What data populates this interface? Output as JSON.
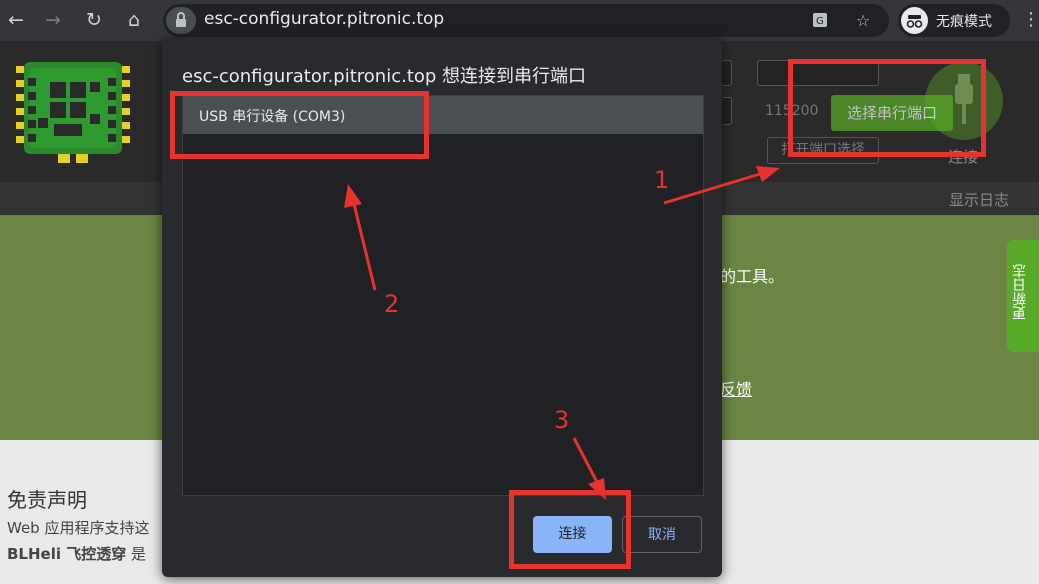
{
  "browser": {
    "url": "esc-configurator.pitronic.top",
    "incognito_label": "无痕模式"
  },
  "page": {
    "baud_value": "115200",
    "choose_port_button": "选择串行端口",
    "open_port_button": "打开端口选择",
    "connect_label": "连接",
    "show_log": "显示日志",
    "green_text_1": "的工具。",
    "green_text_2": "反馈",
    "update_log_tab": "更新日志",
    "disclaimer_title": "免责声明",
    "disclaimer_line_1": "Web 应用程序支持这",
    "disclaimer_line_2_bold": "BLHeli 飞控透穿",
    "disclaimer_line_2_rest": " 是"
  },
  "dialog": {
    "title": "esc-configurator.pitronic.top 想连接到串行端口",
    "devices": [
      "USB 串行设备 (COM3)"
    ],
    "connect_button": "连接",
    "cancel_button": "取消"
  },
  "annotations": [
    "1",
    "2",
    "3"
  ],
  "colors": {
    "annotation": "#e8322f",
    "accent_green": "#59aa29",
    "dialog_primary": "#8ab4f8"
  }
}
